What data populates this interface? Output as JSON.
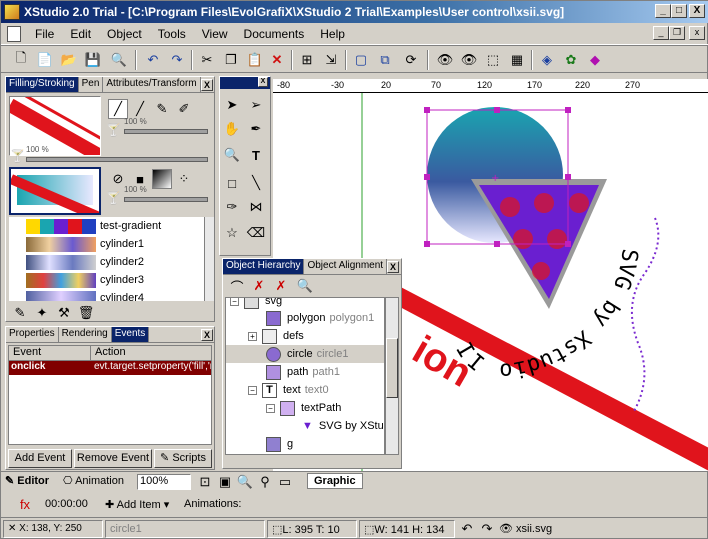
{
  "window": {
    "title": "XStudio 2.0 Trial - [C:\\Program Files\\EvolGrafiX\\XStudio 2 Trial\\Examples\\User control\\xsii.svg]",
    "minimize": "_",
    "maximize": "□",
    "close": "X"
  },
  "menu": {
    "items": [
      "File",
      "Edit",
      "Object",
      "Tools",
      "View",
      "Documents",
      "Help"
    ]
  },
  "fill_panel": {
    "tabs": [
      "Filling/Stroking",
      "Pen",
      "Attributes/Transform"
    ],
    "close": "X",
    "opacity1": "100 %",
    "opacity2": "100 %",
    "opacity3": "100 %",
    "gradients": [
      {
        "name": "test-gradient"
      },
      {
        "name": "cylinder1"
      },
      {
        "name": "cylinder2"
      },
      {
        "name": "cylinder3"
      },
      {
        "name": "cylinder4"
      }
    ]
  },
  "properties_panel": {
    "tabs": [
      "Properties",
      "Rendering",
      "Events"
    ],
    "close": "X",
    "col_event": "Event",
    "col_action": "Action",
    "row_event": "onclick",
    "row_action": "evt.target.setproperty('fill','r",
    "add_event": "Add Event",
    "remove_event": "Remove Event",
    "scripts": "Scripts"
  },
  "hierarchy_panel": {
    "tabs": [
      "Object Hierarchy",
      "Object Alignment"
    ],
    "close": "X",
    "rows": [
      {
        "name": "svg",
        "id": ""
      },
      {
        "name": "polygon",
        "id": "polygon1"
      },
      {
        "name": "defs",
        "id": ""
      },
      {
        "name": "circle",
        "id": "circle1"
      },
      {
        "name": "path",
        "id": "path1"
      },
      {
        "name": "text",
        "id": "text0"
      },
      {
        "name": "textPath",
        "id": ""
      },
      {
        "name": "SVG by XStu",
        "id": ""
      },
      {
        "name": "g",
        "id": ""
      }
    ]
  },
  "ruler": {
    "ticks": [
      "-80",
      "-30",
      "20",
      "70",
      "120",
      "170",
      "220",
      "270"
    ]
  },
  "canvas": {
    "text_path": "SVG by Xstudio II",
    "red_text": "ion"
  },
  "bottom_bar": {
    "tab_editor": "Editor",
    "tab_animation": "Animation",
    "zoom": "100%",
    "tab_graphic": "Graphic",
    "time": "00:00:00",
    "add_item": "Add Item",
    "animations_label": "Animations:"
  },
  "status": {
    "coords": "X: 138, Y: 250",
    "selection": "circle1",
    "position": "L: 395  T: 10",
    "size": "W: 141  H: 134",
    "file": "xsii.svg"
  },
  "colors": {
    "title_active": "#0a246a",
    "teal": "#1aa5b0",
    "purple": "#6a1fd0",
    "red": "#e0141c"
  }
}
